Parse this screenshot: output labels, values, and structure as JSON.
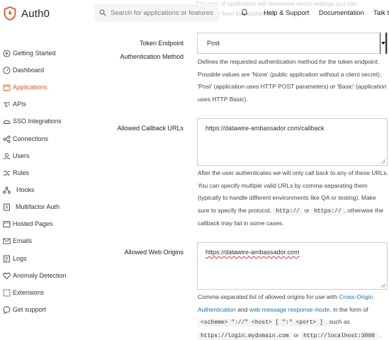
{
  "header": {
    "brand": "Auth0",
    "search_placeholder": "Search for applications or features",
    "faded_text": "The type of application will determine which settings you can configure from the dashboard.",
    "nav": [
      "Help & Support",
      "Documentation",
      "Talk t"
    ]
  },
  "sidebar": {
    "items": [
      {
        "label": "Getting Started",
        "icon": "play-circle-icon"
      },
      {
        "label": "Dashboard",
        "icon": "gauge-icon"
      },
      {
        "label": "Applications",
        "icon": "applications-icon",
        "active": true
      },
      {
        "label": "APIs",
        "icon": "api-icon"
      },
      {
        "label": "SSO Integrations",
        "icon": "cloud-icon"
      },
      {
        "label": "Connections",
        "icon": "connections-icon"
      },
      {
        "label": "Users",
        "icon": "user-icon"
      },
      {
        "label": "Rules",
        "icon": "rules-icon"
      },
      {
        "label": "Hooks",
        "icon": "hooks-icon"
      },
      {
        "label": "Multifactor Auth",
        "icon": "multifactor-icon"
      },
      {
        "label": "Hosted Pages",
        "icon": "hosted-pages-icon"
      },
      {
        "label": "Emails",
        "icon": "email-icon"
      },
      {
        "label": "Logs",
        "icon": "logs-icon"
      },
      {
        "label": "Anomaly Detection",
        "icon": "heart-icon"
      },
      {
        "label": "Extensions",
        "icon": "extensions-icon"
      },
      {
        "label": "Get support",
        "icon": "chat-icon"
      }
    ],
    "active_color": "#eb5424"
  },
  "form": {
    "token_endpoint": {
      "label": "Token Endpoint",
      "sublabel": "Authentication Method",
      "value": "Post",
      "help": "Defines the requested authentication method for the token endpoint. Possible values are 'None' (public application without a client secret), 'Post' (application uses HTTP POST parameters) or 'Basic' (application uses HTTP Basic)."
    },
    "callbacks": {
      "label": "Allowed Callback URLs",
      "value": "https://datawire-ambassador.com/callback",
      "help_1": "After the user authenticates we will only call back to any of these URLs. You can specify multiple valid URLs by comma-separating them (typically to handle different environments like QA or testing). Make sure to specify the protocol,",
      "code_1": "http://",
      "or": "or",
      "code_2": "https://",
      "help_2": ", otherwise the callback may fail in some cases."
    },
    "web_origins": {
      "label": "Allowed Web Origins",
      "value": "https://datawire-ambassador.com",
      "help_1": "Comma-separated list of allowed origins for use with",
      "link_1": "Cross-Origin Authentication",
      "and": "and",
      "link_2": "web message response mode",
      "help_2": ", in the form of",
      "code_1": "<scheme> \"://\" <host> [ \":\" <port> ]",
      "such_as": ", such as",
      "code_2": "https://login.mydomain.com",
      "or": "or",
      "code_3": "http://localhost:3000",
      "end": "."
    }
  }
}
